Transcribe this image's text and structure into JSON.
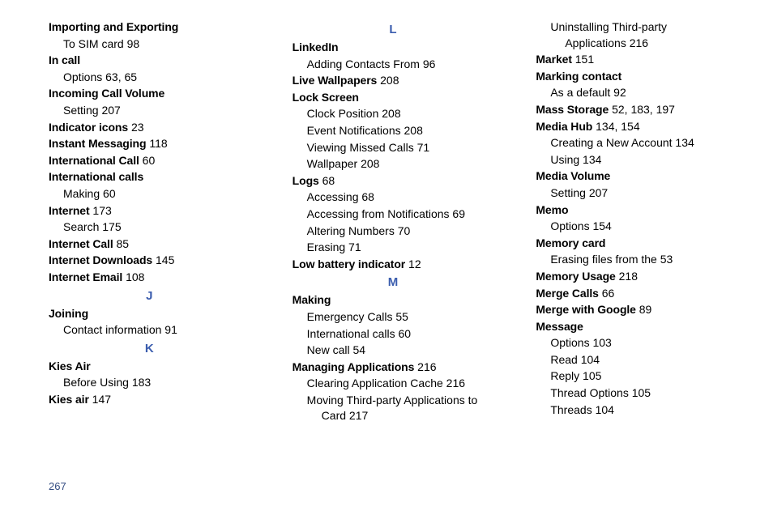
{
  "pageNumber": "267",
  "columns": [
    [
      {
        "t": "term",
        "text": "Importing and Exporting"
      },
      {
        "t": "sub",
        "text": "To SIM card",
        "page": "98"
      },
      {
        "t": "term",
        "text": "In call"
      },
      {
        "t": "sub",
        "text": "Options",
        "page": "63",
        "page2": "65"
      },
      {
        "t": "term",
        "text": "Incoming Call Volume"
      },
      {
        "t": "sub",
        "text": "Setting",
        "page": "207"
      },
      {
        "t": "term",
        "text": "Indicator icons",
        "page": "23"
      },
      {
        "t": "term",
        "text": "Instant Messaging",
        "page": "118"
      },
      {
        "t": "term",
        "text": "International Call",
        "page": "60"
      },
      {
        "t": "term",
        "text": "International calls"
      },
      {
        "t": "sub",
        "text": "Making",
        "page": "60"
      },
      {
        "t": "term",
        "text": "Internet",
        "page": "173"
      },
      {
        "t": "sub",
        "text": "Search",
        "page": "175"
      },
      {
        "t": "term",
        "text": "Internet Call",
        "page": "85"
      },
      {
        "t": "term",
        "text": "Internet Downloads",
        "page": "145"
      },
      {
        "t": "term",
        "text": "Internet Email",
        "page": "108"
      },
      {
        "t": "letter",
        "text": "J"
      },
      {
        "t": "term",
        "text": "Joining"
      },
      {
        "t": "sub",
        "text": "Contact information",
        "page": "91"
      },
      {
        "t": "letter",
        "text": "K"
      },
      {
        "t": "term",
        "text": "Kies Air"
      },
      {
        "t": "sub",
        "text": "Before Using",
        "page": "183"
      },
      {
        "t": "term",
        "text": "Kies air",
        "page": "147"
      }
    ],
    [
      {
        "t": "letter",
        "text": "L"
      },
      {
        "t": "term",
        "text": "LinkedIn"
      },
      {
        "t": "sub",
        "text": "Adding Contacts From",
        "page": "96"
      },
      {
        "t": "term",
        "text": "Live Wallpapers",
        "page": "208"
      },
      {
        "t": "term",
        "text": "Lock Screen"
      },
      {
        "t": "sub",
        "text": "Clock Position",
        "page": "208"
      },
      {
        "t": "sub",
        "text": "Event Notifications",
        "page": "208"
      },
      {
        "t": "sub",
        "text": "Viewing Missed Calls",
        "page": "71"
      },
      {
        "t": "sub",
        "text": "Wallpaper",
        "page": "208"
      },
      {
        "t": "term",
        "text": "Logs",
        "page": "68"
      },
      {
        "t": "sub",
        "text": "Accessing",
        "page": "68"
      },
      {
        "t": "sub",
        "text": "Accessing from Notifications",
        "page": "69"
      },
      {
        "t": "sub",
        "text": "Altering Numbers",
        "page": "70"
      },
      {
        "t": "sub",
        "text": "Erasing",
        "page": "71"
      },
      {
        "t": "term",
        "text": "Low battery indicator",
        "page": "12"
      },
      {
        "t": "letter",
        "text": "M"
      },
      {
        "t": "term",
        "text": "Making"
      },
      {
        "t": "sub",
        "text": "Emergency Calls",
        "page": "55"
      },
      {
        "t": "sub",
        "text": "International calls",
        "page": "60"
      },
      {
        "t": "sub",
        "text": "New call",
        "page": "54"
      },
      {
        "t": "term",
        "text": "Managing Applications",
        "page": "216"
      },
      {
        "t": "sub",
        "text": "Clearing Application Cache",
        "page": "216"
      },
      {
        "t": "sub",
        "text": "Moving Third-party Applications to Card",
        "page": "217",
        "wrap": true
      }
    ],
    [
      {
        "t": "sub",
        "text": "Uninstalling Third-party Applications",
        "page": "216",
        "wrap": true
      },
      {
        "t": "term",
        "text": "Market",
        "page": "151"
      },
      {
        "t": "term",
        "text": "Marking contact"
      },
      {
        "t": "sub",
        "text": "As a default",
        "page": "92"
      },
      {
        "t": "term",
        "text": "Mass Storage",
        "page": "52",
        "page2": "183",
        "page3": "197"
      },
      {
        "t": "term",
        "text": "Media Hub",
        "page": "134",
        "page2": "154"
      },
      {
        "t": "sub",
        "text": "Creating a New Account",
        "page": "134"
      },
      {
        "t": "sub",
        "text": "Using",
        "page": "134"
      },
      {
        "t": "term",
        "text": "Media Volume"
      },
      {
        "t": "sub",
        "text": "Setting",
        "page": "207"
      },
      {
        "t": "term",
        "text": "Memo"
      },
      {
        "t": "sub",
        "text": "Options",
        "page": "154"
      },
      {
        "t": "term",
        "text": "Memory card"
      },
      {
        "t": "sub",
        "text": "Erasing files from the",
        "page": "53"
      },
      {
        "t": "term",
        "text": "Memory Usage",
        "page": "218"
      },
      {
        "t": "term",
        "text": "Merge Calls",
        "page": "66"
      },
      {
        "t": "term",
        "text": "Merge with Google",
        "page": "89"
      },
      {
        "t": "term",
        "text": "Message"
      },
      {
        "t": "sub",
        "text": "Options",
        "page": "103"
      },
      {
        "t": "sub",
        "text": "Read",
        "page": "104"
      },
      {
        "t": "sub",
        "text": "Reply",
        "page": "105"
      },
      {
        "t": "sub",
        "text": "Thread Options",
        "page": "105"
      },
      {
        "t": "sub",
        "text": "Threads",
        "page": "104"
      }
    ]
  ]
}
